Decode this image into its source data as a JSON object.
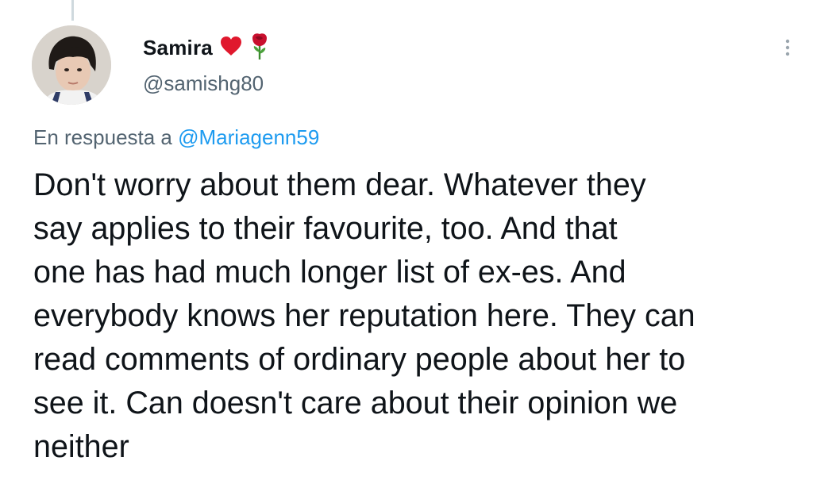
{
  "tweet": {
    "author": {
      "display_name": "Samira",
      "emojis": [
        "heart-emoji",
        "rose-emoji"
      ],
      "handle": "@samishg80"
    },
    "reply_prefix": "En respuesta a ",
    "reply_to_handle": "@Mariagenn59",
    "text": "Don't worry about them dear. Whatever they\nsay applies to their favourite, too. And that\none has had much longer list of ex-es. And\neverybody knows her reputation here. They can\nread comments of ordinary people about her to\nsee it.  Can doesn't care about their opinion we\nneither",
    "more_icon": "more-vertical-icon"
  },
  "colors": {
    "text": "#0f1419",
    "secondary": "#536471",
    "link": "#1d9bf0",
    "heart": "#e0182d",
    "rose": "#c8102e"
  }
}
